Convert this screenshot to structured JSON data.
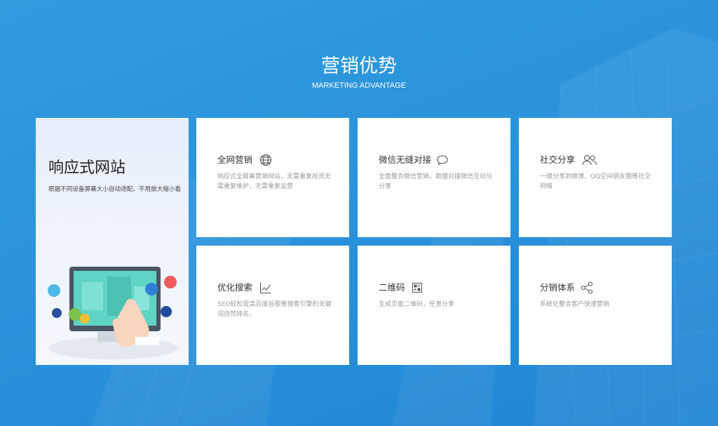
{
  "header": {
    "title": "营销优势",
    "subtitle": "MARKETING ADVANTAGE"
  },
  "hero": {
    "title": "响应式网站",
    "description": "根据不同设备屏幕大小自动适配。不用放大缩小看"
  },
  "cards": [
    {
      "title": "全网营销",
      "icon": "globe-icon",
      "description": "响应式全屏幕营销网站，无需重复投资无需重复维护，无需重复运营"
    },
    {
      "title": "微信无缝对接",
      "icon": "wechat-chat-icon",
      "description": "全面整合微信营销，数据对接微信互动与分享"
    },
    {
      "title": "社交分享",
      "icon": "users-icon",
      "description": "一键分享到微博、QQ空间朋友圈等社交网络"
    },
    {
      "title": "优化搜索",
      "icon": "trend-chart-icon",
      "description": "SEO轻松提高百度谷歌等搜索引擎的关键词自然排名。"
    },
    {
      "title": "二维码",
      "icon": "qr-code-icon",
      "description": "生成页面二维码，任意分享"
    },
    {
      "title": "分销体系",
      "icon": "share-nodes-icon",
      "description": "系统化整合客户快速营销"
    }
  ],
  "colors": {
    "background": "#2b93dc",
    "card": "#ffffff",
    "card_title": "#333333",
    "card_desc": "#9a9a9a"
  }
}
